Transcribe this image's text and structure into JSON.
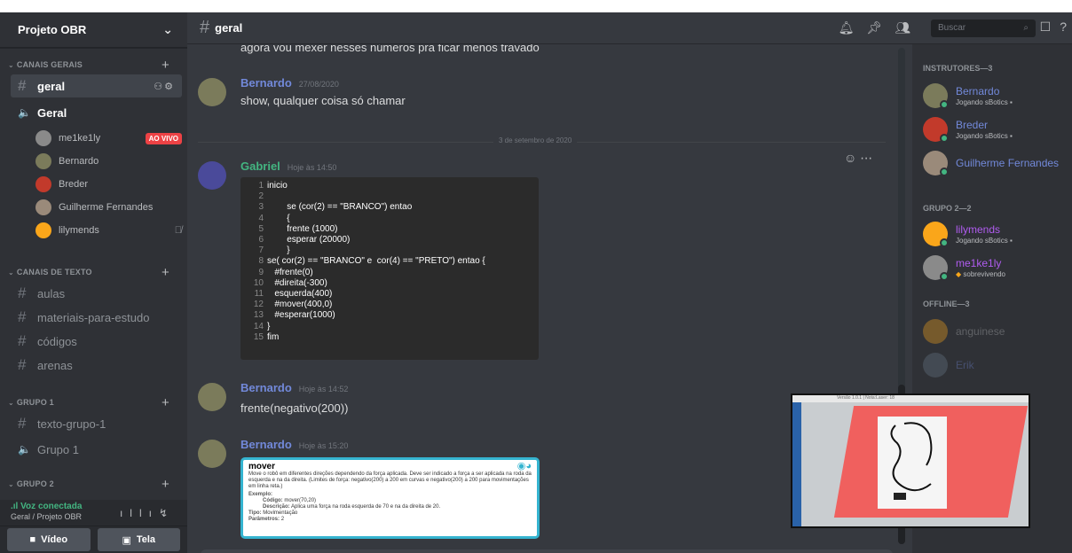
{
  "server": {
    "name": "Projeto OBR"
  },
  "sidebar": {
    "cat_gerais": "CANAIS GERAIS",
    "channel_geral": "geral",
    "voice_geral": "Geral",
    "voice_users": [
      {
        "name": "me1ke1ly",
        "badge": "AO VIVO",
        "color": "#8a8a8a"
      },
      {
        "name": "Bernardo",
        "color": "#7b7b5b"
      },
      {
        "name": "Breder",
        "color": "#c23a2b"
      },
      {
        "name": "Guilherme Fernandes",
        "color": "#9a8a7a"
      },
      {
        "name": "lilymends",
        "color": "#faa61a"
      }
    ],
    "cat_texto": "CANAIS DE TEXTO",
    "text_channels": [
      "aulas",
      "materiais-para-estudo",
      "códigos",
      "arenas"
    ],
    "cat_grupo1": "GRUPO 1",
    "grupo1_text": "texto-grupo-1",
    "grupo1_voice": "Grupo 1",
    "cat_grupo2": "GRUPO 2",
    "voice_status": "Voz conectada",
    "voice_location": "Geral / Projeto OBR",
    "btn_video": "Vídeo",
    "btn_tela": "Tela"
  },
  "header": {
    "channel": "geral",
    "search_placeholder": "Buscar"
  },
  "messages": {
    "top_text": "agora vou mexer nesses números pra ficar menos travado",
    "m1": {
      "author": "Bernardo",
      "time": "27/08/2020",
      "text": "show, qualquer coisa só chamar"
    },
    "divider": "3 de setembro de 2020",
    "m2": {
      "author": "Gabriel",
      "time": "Hoje às 14:50"
    },
    "code_lines": [
      {
        "n": "1",
        "t": "inicio"
      },
      {
        "n": "2",
        "t": ""
      },
      {
        "n": "3",
        "t": "        se (cor(2) == \"BRANCO\") entao"
      },
      {
        "n": "4",
        "t": "        {"
      },
      {
        "n": "5",
        "t": "        frente (1000)"
      },
      {
        "n": "6",
        "t": "        esperar (20000)"
      },
      {
        "n": "7",
        "t": "        }"
      },
      {
        "n": "8",
        "t": "se( cor(2) == \"BRANCO\" e  cor(4) == \"PRETO\") entao {"
      },
      {
        "n": "9",
        "t": "   #frente(0)"
      },
      {
        "n": "10",
        "t": "   #direita(-300)"
      },
      {
        "n": "11",
        "t": "   esquerda(400)"
      },
      {
        "n": "12",
        "t": "   #mover(400,0)"
      },
      {
        "n": "13",
        "t": "   #esperar(1000)"
      },
      {
        "n": "14",
        "t": "}"
      },
      {
        "n": "15",
        "t": "fim"
      }
    ],
    "m3": {
      "author": "Bernardo",
      "time": "Hoje às 14:52",
      "text": "frente(negativo(200))"
    },
    "m4": {
      "author": "Bernardo",
      "time": "Hoje às 15:20"
    },
    "embed": {
      "title": "mover",
      "desc": "Move o robô em diferentes direções dependendo da força aplicada. Deve ser indicado a força a ser aplicada na roda da esquerda e na da direita. (Limites de força: negativo(200) a 200 em curvas e negativo(200) a 200 para movimentações em linha reta.)",
      "example_label": "Exemplo:",
      "code_label": "Código:",
      "code_value": "mover(70,20)",
      "desc_label": "Descrição:",
      "desc_value": "Aplica uma força na roda esquerda de 70 e na da direita de 20.",
      "type_label": "Tipo:",
      "type_value": "Movimentação",
      "params_label": "Parâmetros:",
      "params_value": "2"
    }
  },
  "members": {
    "cat_instrutores": "INSTRUTORES—3",
    "instrutores": [
      {
        "name": "Bernardo",
        "status": "Jogando sBotics",
        "color": "#7289da",
        "av": "#7b7b5b"
      },
      {
        "name": "Breder",
        "status": "Jogando sBotics",
        "color": "#7289da",
        "av": "#c23a2b"
      },
      {
        "name": "Guilherme Fernandes",
        "status": "",
        "color": "#7289da",
        "av": "#9a8a7a"
      }
    ],
    "cat_grupo2": "GRUPO 2—2",
    "grupo2": [
      {
        "name": "lilymends",
        "status": "Jogando sBotics",
        "color": "#b05cf0",
        "av": "#faa61a"
      },
      {
        "name": "me1ke1ly",
        "status": "sobrevivendo",
        "color": "#b05cf0",
        "av": "#8a8a8a"
      }
    ],
    "cat_offline": "OFFLINE—3",
    "offline": [
      {
        "name": "anguinese",
        "color": "#b9bbbe",
        "av": "#faa61a"
      },
      {
        "name": "Erik",
        "color": "#7289da",
        "av": "#6a7a8a"
      }
    ]
  },
  "video": {
    "window_title": "Versão 1.0.1 | Nota:Laser: 18"
  }
}
